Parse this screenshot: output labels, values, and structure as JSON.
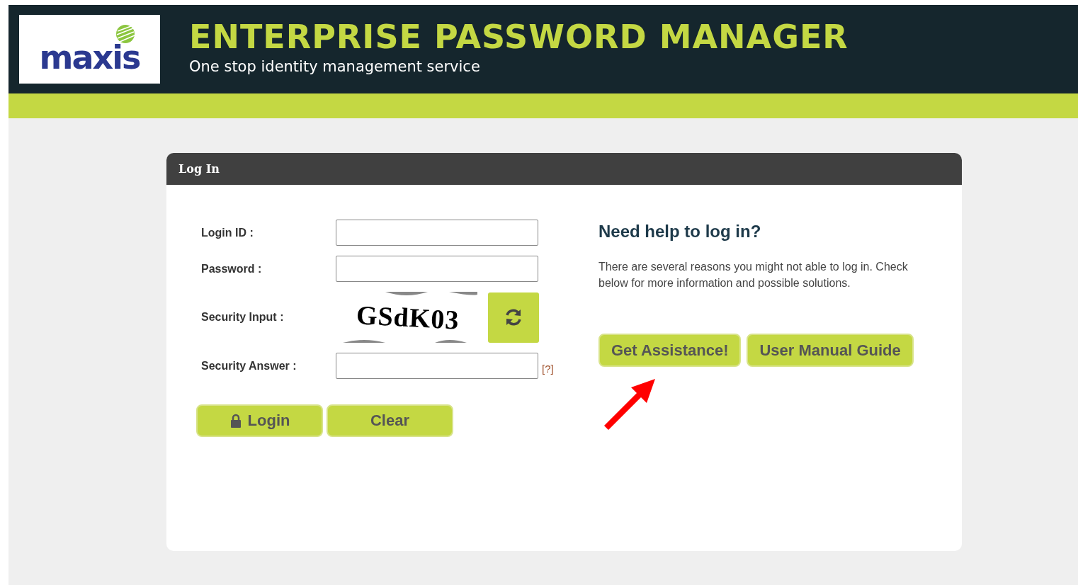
{
  "header": {
    "logo_text": "maxis",
    "title": "ENTERPRISE PASSWORD MANAGER",
    "subtitle": "One stop identity management service"
  },
  "login_panel": {
    "title": "Log In",
    "fields": [
      {
        "kind": "text",
        "label": "Login ID :"
      },
      {
        "kind": "password",
        "label": "Password :"
      },
      {
        "kind": "captcha",
        "label": "Security Input :",
        "captcha_text": "GSdK03"
      },
      {
        "kind": "answer",
        "label": "Security Answer :",
        "help_link": "[?]"
      }
    ],
    "buttons": [
      {
        "kind": "lock",
        "label": "Login"
      },
      {
        "kind": "plain",
        "label": "Clear"
      }
    ]
  },
  "help": {
    "heading": "Need help to log in?",
    "text": "There are several reasons you might not able to log in. Check below for more information and possible solutions.",
    "buttons": [
      "Get Assistance!",
      "User Manual Guide"
    ]
  }
}
